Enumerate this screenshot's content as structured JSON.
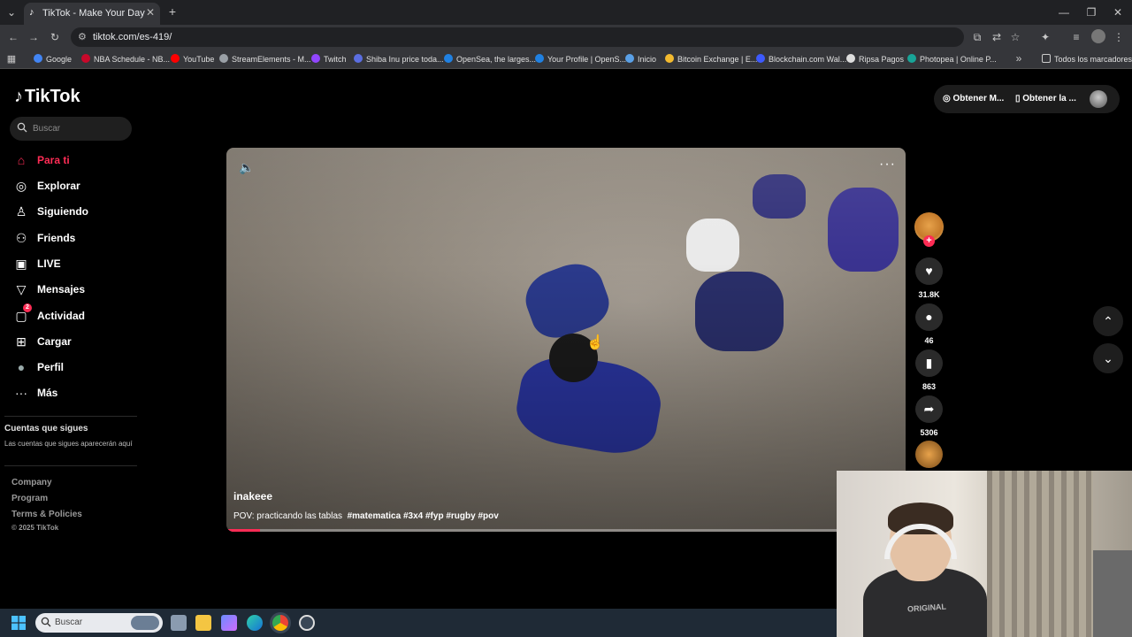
{
  "browser": {
    "tab_title": "TikTok - Make Your Day",
    "tab_close": "✕",
    "new_tab": "+",
    "url": "tiktok.com/es-419/",
    "bookmarks": [
      {
        "label": "Google",
        "color": "#4285f4"
      },
      {
        "label": "NBA Schedule - NB...",
        "color": "#c9082a"
      },
      {
        "label": "YouTube",
        "color": "#ff0000"
      },
      {
        "label": "StreamElements - M...",
        "color": "#9aa0a6"
      },
      {
        "label": "Twitch",
        "color": "#9146ff"
      },
      {
        "label": "Shiba Inu price toda...",
        "color": "#5b6ee1"
      },
      {
        "label": "OpenSea, the larges...",
        "color": "#2081e2"
      },
      {
        "label": "Your Profile | OpenS...",
        "color": "#2081e2"
      },
      {
        "label": "Inicio",
        "color": "#5aa0e6"
      },
      {
        "label": "Bitcoin Exchange | E...",
        "color": "#f3ba2f"
      },
      {
        "label": "Blockchain.com Wal...",
        "color": "#3d5afe"
      },
      {
        "label": "Ripsa Pagos",
        "color": "#dddddd"
      },
      {
        "label": "Photopea | Online P...",
        "color": "#18a497"
      }
    ],
    "all_bookmarks": "Todos los marcadores"
  },
  "tiktok": {
    "logo": "TikTok",
    "search_placeholder": "Buscar",
    "nav": [
      {
        "label": "Para ti",
        "icon": "home-icon",
        "glyph": "⌂"
      },
      {
        "label": "Explorar",
        "icon": "compass-icon",
        "glyph": "◎"
      },
      {
        "label": "Siguiendo",
        "icon": "following-icon",
        "glyph": "♙"
      },
      {
        "label": "Friends",
        "icon": "friends-icon",
        "glyph": "⚇"
      },
      {
        "label": "LIVE",
        "icon": "live-icon",
        "glyph": "▣"
      },
      {
        "label": "Mensajes",
        "icon": "messages-icon",
        "glyph": "▽"
      },
      {
        "label": "Actividad",
        "icon": "activity-icon",
        "glyph": "▢",
        "badge": "2"
      },
      {
        "label": "Cargar",
        "icon": "upload-icon",
        "glyph": "⊞"
      },
      {
        "label": "Perfil",
        "icon": "profile-avatar-icon",
        "glyph": "●"
      },
      {
        "label": "Más",
        "icon": "more-icon",
        "glyph": "···"
      }
    ],
    "following_heading": "Cuentas que sigues",
    "following_sub": "Las cuentas que sigues aparecerán aquí",
    "footer": {
      "company": "Company",
      "program": "Program",
      "terms": "Terms & Policies",
      "copyright": "© 2025 TikTok"
    },
    "top_right": {
      "coins": "Obtener M...",
      "app": "Obtener la ..."
    },
    "video": {
      "username": "inakeee",
      "caption": "POV: practicando las tablas",
      "hashtags": "#matematica #3x4 #fyp #rugby #pov",
      "progress": 0.05
    },
    "actions": {
      "likes": "31.8K",
      "comments": "46",
      "saves": "863",
      "shares": "5306"
    }
  },
  "webcam": {
    "shirt_text": "ORIGINAL"
  },
  "taskbar": {
    "search_placeholder": "Buscar"
  },
  "colors": {
    "accent": "#fe2c55",
    "chrome_bg": "#35363a",
    "page_bg": "#000000"
  }
}
